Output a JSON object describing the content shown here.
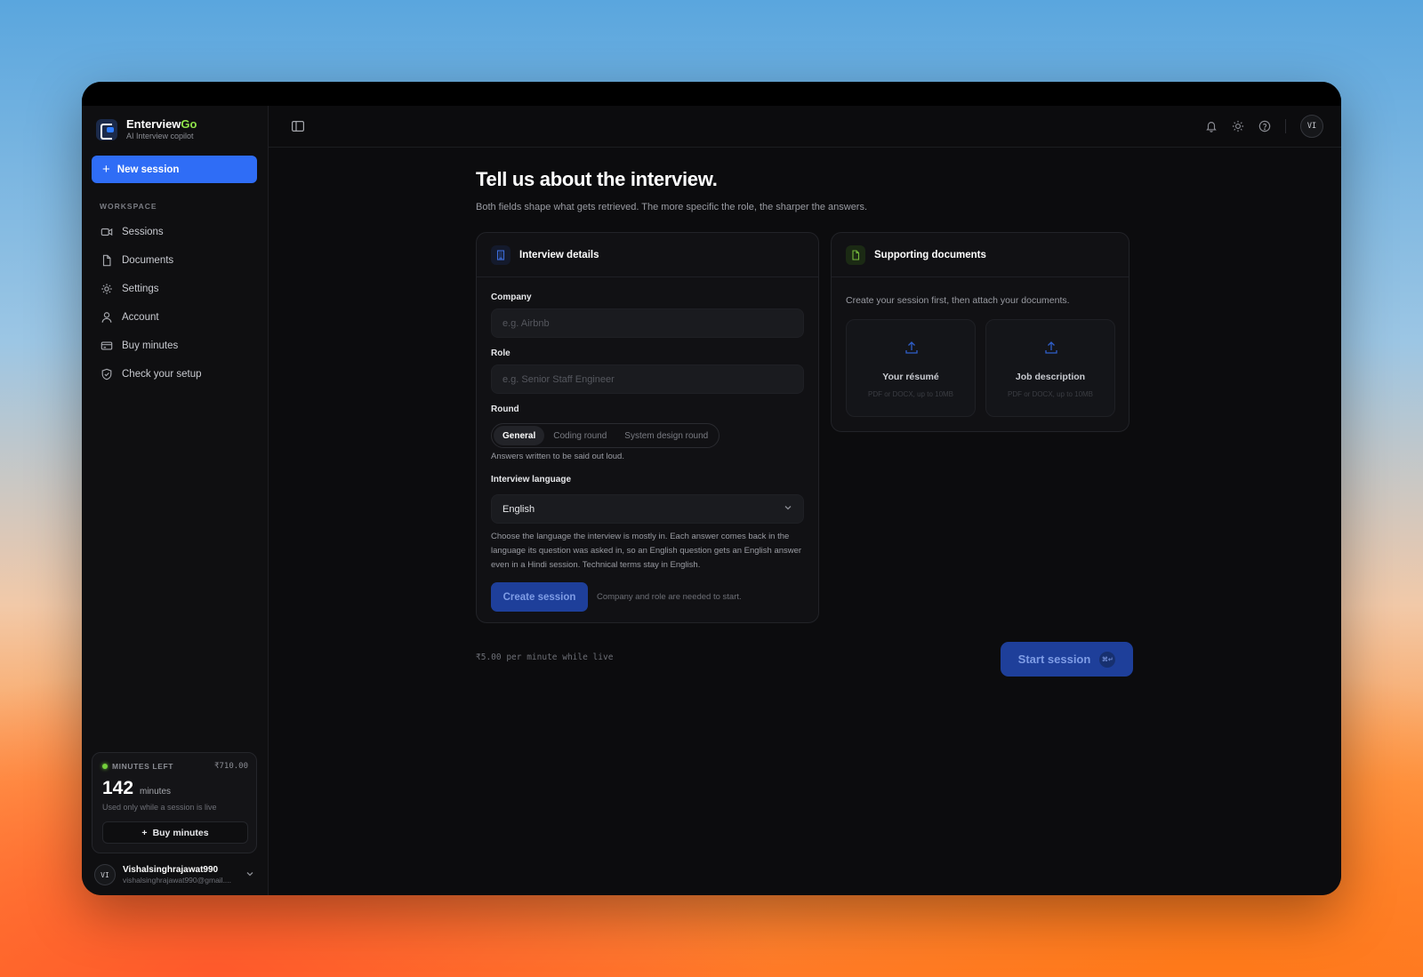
{
  "brand": {
    "name": "Enterview",
    "name_accent": "Go",
    "subtitle": "AI Interview copilot"
  },
  "sidebar": {
    "new_session_label": "New session",
    "section_label": "WORKSPACE",
    "items": [
      {
        "label": "Sessions",
        "icon": "video-icon"
      },
      {
        "label": "Documents",
        "icon": "document-icon"
      },
      {
        "label": "Settings",
        "icon": "gear-icon"
      },
      {
        "label": "Account",
        "icon": "user-icon"
      },
      {
        "label": "Buy minutes",
        "icon": "card-icon"
      },
      {
        "label": "Check your setup",
        "icon": "shield-icon"
      }
    ],
    "minutes": {
      "label": "MINUTES LEFT",
      "balance": "₹710.00",
      "count": "142",
      "unit": "minutes",
      "note": "Used only while a session is live",
      "buy_label": "Buy minutes"
    },
    "user": {
      "initials": "VI",
      "name": "Vishalsinghrajawat990",
      "email": "vishalsinghrajawat990@gmail...."
    }
  },
  "topbar": {
    "avatar_initials": "VI"
  },
  "main": {
    "title": "Tell us about the interview.",
    "subtitle": "Both fields shape what gets retrieved. The more specific the role, the sharper the answers.",
    "details": {
      "title": "Interview details",
      "company_label": "Company",
      "company_placeholder": "e.g. Airbnb",
      "role_label": "Role",
      "role_placeholder": "e.g. Senior Staff Engineer",
      "round_label": "Round",
      "rounds": [
        "General",
        "Coding round",
        "System design round"
      ],
      "round_hint": "Answers written to be said out loud.",
      "language_label": "Interview language",
      "language_value": "English",
      "language_hint": "Choose the language the interview is mostly in. Each answer comes back in the language its question was asked in, so an English question gets an English answer even in a Hindi session. Technical terms stay in English.",
      "create_label": "Create session",
      "create_hint": "Company and role are needed to start."
    },
    "docs": {
      "title": "Supporting documents",
      "subtitle": "Create your session first, then attach your documents.",
      "resume_title": "Your résumé",
      "resume_sub": "PDF or DOCX, up to 10MB",
      "jd_title": "Job description",
      "jd_sub": "PDF or DOCX, up to 10MB"
    },
    "price": "₹5.00 per minute while live",
    "start_label": "Start session",
    "start_shortcut": "⌘↵"
  },
  "colors": {
    "accent": "#2f6df6",
    "live": "#74d13b",
    "brand_accent": "#8fe34a"
  }
}
